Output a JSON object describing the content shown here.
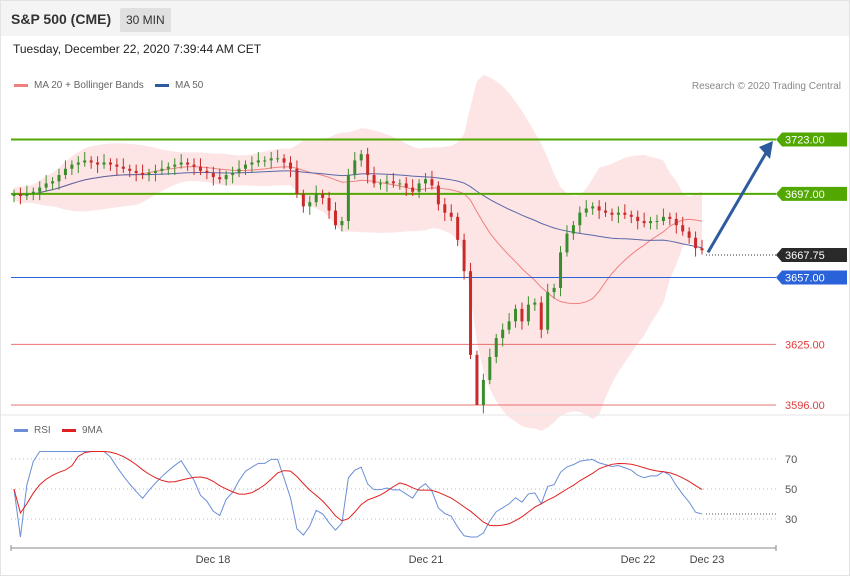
{
  "header": {
    "instrument": "S&P 500 (CME)",
    "interval": "30 MIN"
  },
  "datetime": "Tuesday, December 22, 2020 7:39:44 AM CET",
  "legend": {
    "ma20": "MA 20 + Bollinger Bands",
    "ma50": "MA 50",
    "rsi": "RSI",
    "rsi_ma": "9MA"
  },
  "credit": "Research © 2020 Trading Central",
  "colors": {
    "up": "#3a8d2c",
    "down": "#c92a2a",
    "resistance": "#52a800",
    "support_blue": "#2962d9",
    "support_red": "#e23c3c",
    "band_fill": "#fde0e0",
    "ma20": "#f08080",
    "ma50": "#5a67a8",
    "arrow": "#2e5a9e",
    "rsi": "#6b8ed6",
    "rsi_ma": "#e02020"
  },
  "chart_data": {
    "type": "candlestick",
    "ylim": [
      3590,
      3760
    ],
    "levels": [
      {
        "value": 3723.0,
        "label": "3723.00",
        "kind": "resistance"
      },
      {
        "value": 3697.0,
        "label": "3697.00",
        "kind": "resistance"
      },
      {
        "value": 3667.75,
        "label": "3667.75",
        "kind": "last"
      },
      {
        "value": 3657.0,
        "label": "3657.00",
        "kind": "support"
      },
      {
        "value": 3625.0,
        "label": "3625.00",
        "kind": "support-red"
      },
      {
        "value": 3596.0,
        "label": "3596.00",
        "kind": "support-red"
      }
    ],
    "xticks": [
      "Dec 18",
      "Dec 21",
      "Dec 22",
      "Dec 23"
    ],
    "closes": [
      3697,
      3696,
      3697,
      3698,
      3700,
      3702,
      3703,
      3706,
      3709,
      3711,
      3712,
      3713,
      3712,
      3711,
      3712,
      3711,
      3710,
      3709,
      3708,
      3707,
      3706,
      3707,
      3708,
      3709,
      3710,
      3711,
      3712,
      3711,
      3710,
      3708,
      3707,
      3705,
      3704,
      3706,
      3707,
      3709,
      3711,
      3712,
      3713,
      3713,
      3714,
      3714,
      3712,
      3709,
      3697,
      3691,
      3693,
      3697,
      3695,
      3689,
      3682,
      3684,
      3706,
      3713,
      3716,
      3706,
      3702,
      3702,
      3703,
      3702,
      3702,
      3700,
      3698,
      3702,
      3704,
      3701,
      3692,
      3688,
      3686,
      3675,
      3660,
      3620,
      3596,
      3608,
      3619,
      3628,
      3632,
      3636,
      3642,
      3636,
      3644,
      3645,
      3632,
      3650,
      3652,
      3669,
      3678,
      3682,
      3688,
      3690,
      3691,
      3689,
      3688,
      3687,
      3688,
      3687,
      3686,
      3684,
      3683,
      3684,
      3684,
      3686,
      3685,
      3682,
      3679,
      3676,
      3671,
      3670
    ],
    "rsi": {
      "ylim": [
        20,
        80
      ],
      "ticks": [
        70,
        50,
        30
      ]
    }
  }
}
